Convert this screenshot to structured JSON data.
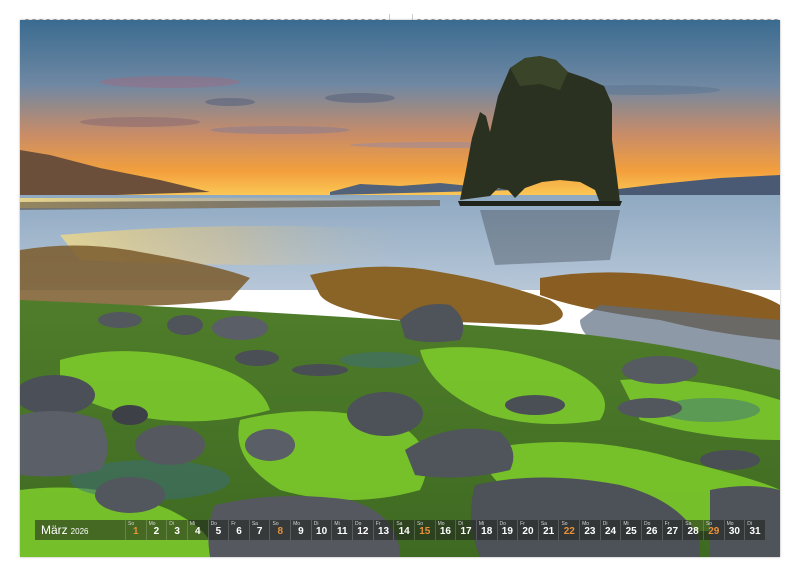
{
  "calendar": {
    "month": "März",
    "year": "2026",
    "colors": {
      "sunday": "#e8913a",
      "weekday": "#ffffff"
    },
    "days": [
      {
        "d": "1",
        "wd": "So"
      },
      {
        "d": "2",
        "wd": "Mo"
      },
      {
        "d": "3",
        "wd": "Di"
      },
      {
        "d": "4",
        "wd": "Mi"
      },
      {
        "d": "5",
        "wd": "Do"
      },
      {
        "d": "6",
        "wd": "Fr"
      },
      {
        "d": "7",
        "wd": "Sa"
      },
      {
        "d": "8",
        "wd": "So"
      },
      {
        "d": "9",
        "wd": "Mo"
      },
      {
        "d": "10",
        "wd": "Di"
      },
      {
        "d": "11",
        "wd": "Mi"
      },
      {
        "d": "12",
        "wd": "Do"
      },
      {
        "d": "13",
        "wd": "Fr"
      },
      {
        "d": "14",
        "wd": "Sa"
      },
      {
        "d": "15",
        "wd": "So"
      },
      {
        "d": "16",
        "wd": "Mo"
      },
      {
        "d": "17",
        "wd": "Di"
      },
      {
        "d": "18",
        "wd": "Mi"
      },
      {
        "d": "19",
        "wd": "Do"
      },
      {
        "d": "20",
        "wd": "Fr"
      },
      {
        "d": "21",
        "wd": "Sa"
      },
      {
        "d": "22",
        "wd": "So"
      },
      {
        "d": "23",
        "wd": "Mo"
      },
      {
        "d": "24",
        "wd": "Di"
      },
      {
        "d": "25",
        "wd": "Mi"
      },
      {
        "d": "26",
        "wd": "Do"
      },
      {
        "d": "27",
        "wd": "Fr"
      },
      {
        "d": "28",
        "wd": "Sa"
      },
      {
        "d": "29",
        "wd": "So"
      },
      {
        "d": "30",
        "wd": "Mo"
      },
      {
        "d": "31",
        "wd": "Di"
      }
    ]
  },
  "photo": {
    "subject": "sea-stack-rock-icon",
    "sky_colors": [
      "#3f6f93",
      "#7c8fa6",
      "#f39a3d",
      "#ffd45a"
    ],
    "moss_color": "#6fbf2a",
    "water_color": "#9fb7cf"
  }
}
